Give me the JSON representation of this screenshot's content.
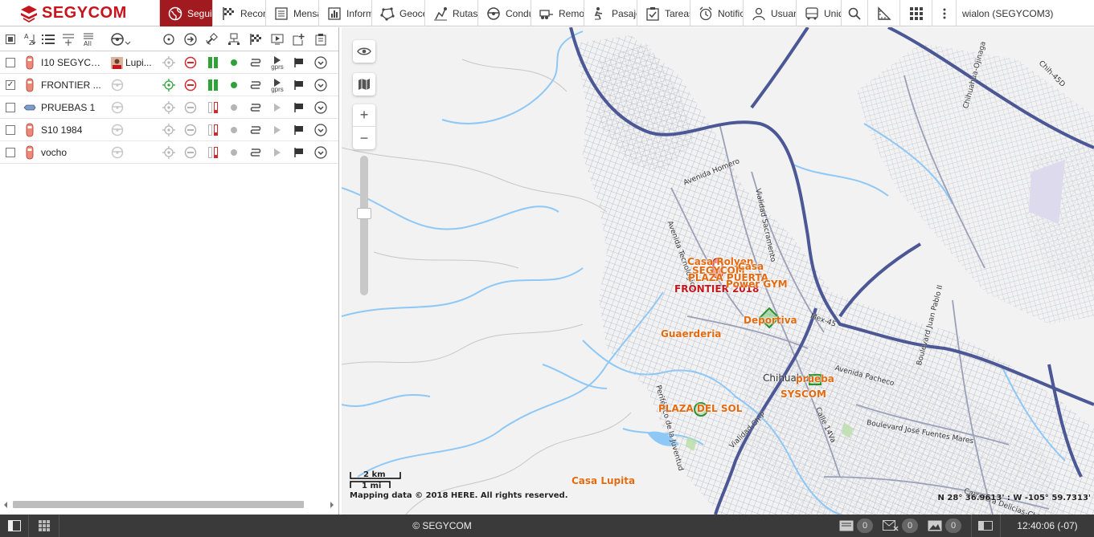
{
  "brand": {
    "name": "SEGYCOM"
  },
  "tabs": [
    {
      "label": "Seguimiento",
      "icon": "globe-icon"
    },
    {
      "label": "Recorridos",
      "icon": "checkered-flag-icon"
    },
    {
      "label": "Mensajes",
      "icon": "document-list-icon"
    },
    {
      "label": "Informes",
      "icon": "bar-chart-icon"
    },
    {
      "label": "Geocercas",
      "icon": "geofence-icon"
    },
    {
      "label": "Rutas",
      "icon": "route-icon"
    },
    {
      "label": "Conductores",
      "icon": "steering-wheel-icon"
    },
    {
      "label": "Remolques",
      "icon": "trailer-icon"
    },
    {
      "label": "Pasajeros",
      "icon": "passenger-icon"
    },
    {
      "label": "Tareas",
      "icon": "task-icon"
    },
    {
      "label": "Notificaciones",
      "icon": "alarm-clock-icon"
    },
    {
      "label": "Usuarios",
      "icon": "user-icon"
    },
    {
      "label": "Unidades",
      "icon": "bus-icon"
    }
  ],
  "user": {
    "label": "wialon (SEGYCOM3)"
  },
  "units": [
    {
      "name": "I10 SEGYCOM",
      "checked": false,
      "driver": "Lupi...",
      "status": "online"
    },
    {
      "name": "FRONTIER ...",
      "checked": true,
      "driver": "",
      "status": "online"
    },
    {
      "name": "PRUEBAS 1",
      "checked": false,
      "driver": "",
      "status": "offline"
    },
    {
      "name": "S10 1984",
      "checked": false,
      "driver": "",
      "status": "offline"
    },
    {
      "name": "vocho",
      "checked": false,
      "driver": "",
      "status": "offline"
    }
  ],
  "conn_label": "gprs",
  "map": {
    "labels": [
      {
        "text": "Casa Rolyen",
        "type": "geofence"
      },
      {
        "text": "SEGYCOM",
        "type": "geofence"
      },
      {
        "text": "Casa",
        "type": "geofence"
      },
      {
        "text": "PLAZA PUERTA",
        "type": "geofence"
      },
      {
        "text": "FRONTIER 2018",
        "type": "unit"
      },
      {
        "text": "Power GYM",
        "type": "geofence"
      },
      {
        "text": "Deportiva",
        "type": "geofence"
      },
      {
        "text": "Guaerderia",
        "type": "geofence"
      },
      {
        "text": "prueba",
        "type": "geofence"
      },
      {
        "text": "SYSCOM",
        "type": "geofence"
      },
      {
        "text": "PLAZA DEL SOL",
        "type": "geofence"
      },
      {
        "text": "Casa Lupita",
        "type": "geofence"
      }
    ],
    "streets": [
      "Avenida Homero",
      "Avenida Tecnológico",
      "Vialidad Sacramento",
      "Mex-45",
      "Chih-45D",
      "Avenida Pacheco",
      "Calle 14Va",
      "Boulevard José Fuentes Mares",
      "Carretera Delicias-Chihuahua",
      "Boulevard Juan Pablo II",
      "Chihuahua-Ojinaga",
      "Periférico de la Juventud",
      "Vialidad Ch-P",
      "Chihuahua"
    ],
    "scale": {
      "km": "2 km",
      "mi": "1 mi"
    },
    "attribution": "Mapping data © 2018 HERE. All rights reserved.",
    "coords": "N 28° 36.9613' : W -105° 59.7313'"
  },
  "footer": {
    "brand": "© SEGYCOM",
    "messages": "0",
    "notifications": "0",
    "images": "0",
    "time": "12:40:06 (-07)"
  },
  "colors": {
    "brand_red": "#c4161c",
    "tab_active": "#a01a1f",
    "label_orange": "#e46a10",
    "online_green": "#2fa33a",
    "stop_red": "#d7262b",
    "water": "#8ec8f6",
    "motorway": "#4b5895"
  }
}
